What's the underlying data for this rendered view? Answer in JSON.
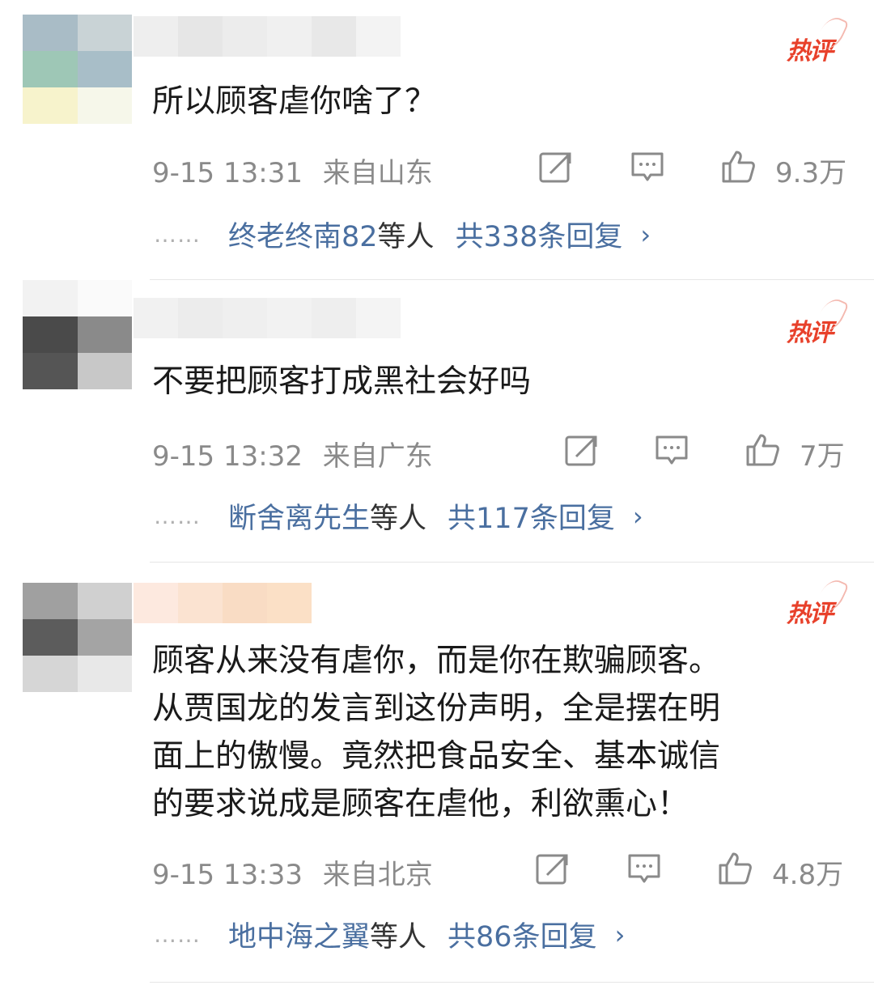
{
  "hot_label": "热评",
  "comments": [
    {
      "text": "所以顾客虐你啥了？",
      "time": "9-15 13:31",
      "location": "来自山东",
      "likes": "9.3万",
      "reply_names": "终老终南82",
      "reply_etc": "等人",
      "reply_total": "共338条回复"
    },
    {
      "text": "不要把顾客打成黑社会好吗",
      "time": "9-15 13:32",
      "location": "来自广东",
      "likes": "7万",
      "reply_names": "断舍离先生",
      "reply_etc": "等人",
      "reply_total": "共117条回复"
    },
    {
      "text": "顾客从来没有虐你，而是你在欺骗顾客。\n从贾国龙的发言到这份声明，全是摆在明\n面上的傲慢。竟然把食品安全、基本诚信\n的要求说成是顾客在虐他，利欲熏心！",
      "time": "9-15 13:33",
      "location": "来自北京",
      "likes": "4.8万",
      "reply_names": "地中海之翼",
      "reply_etc": "等人",
      "reply_total": "共86条回复"
    }
  ],
  "reply_dots": "……",
  "chevron": "›",
  "icons": {
    "share": "share-icon",
    "comment": "comment-icon",
    "like": "thumbs-up-icon"
  }
}
